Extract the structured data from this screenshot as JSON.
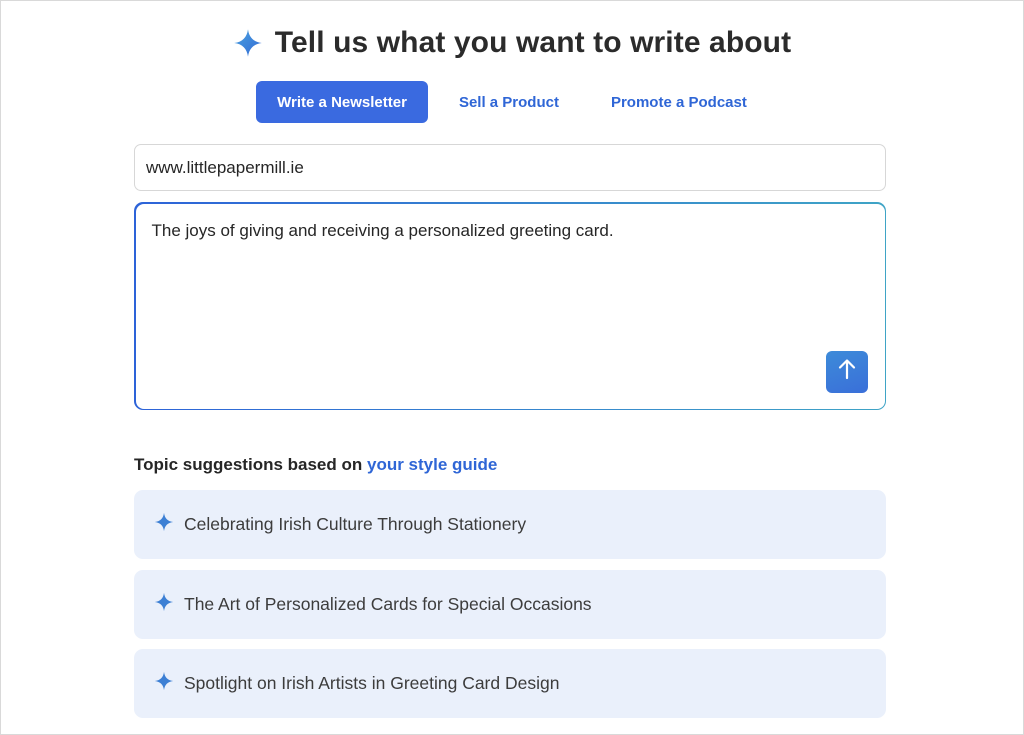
{
  "header": {
    "title": "Tell us what you want to write about",
    "icon": "sparkle-icon"
  },
  "tabs": [
    {
      "label": "Write a Newsletter",
      "active": true
    },
    {
      "label": "Sell a Product",
      "active": false
    },
    {
      "label": "Promote a Podcast",
      "active": false
    }
  ],
  "url_input": {
    "value": "www.littlepapermill.ie"
  },
  "prompt": {
    "value": "The joys of giving and receiving a personalized greeting card.",
    "submit_icon": "arrow-up-icon"
  },
  "suggestions": {
    "heading_prefix": "Topic suggestions based on ",
    "heading_link": "your style guide",
    "items": [
      {
        "label": "Celebrating Irish Culture Through Stationery"
      },
      {
        "label": "The Art of Personalized Cards for Special Occasions"
      },
      {
        "label": "Spotlight on Irish Artists in Greeting Card Design"
      }
    ]
  },
  "colors": {
    "accent": "#3a6ae0",
    "link": "#2f66d6",
    "suggestion_bg": "#eaf0fb"
  }
}
